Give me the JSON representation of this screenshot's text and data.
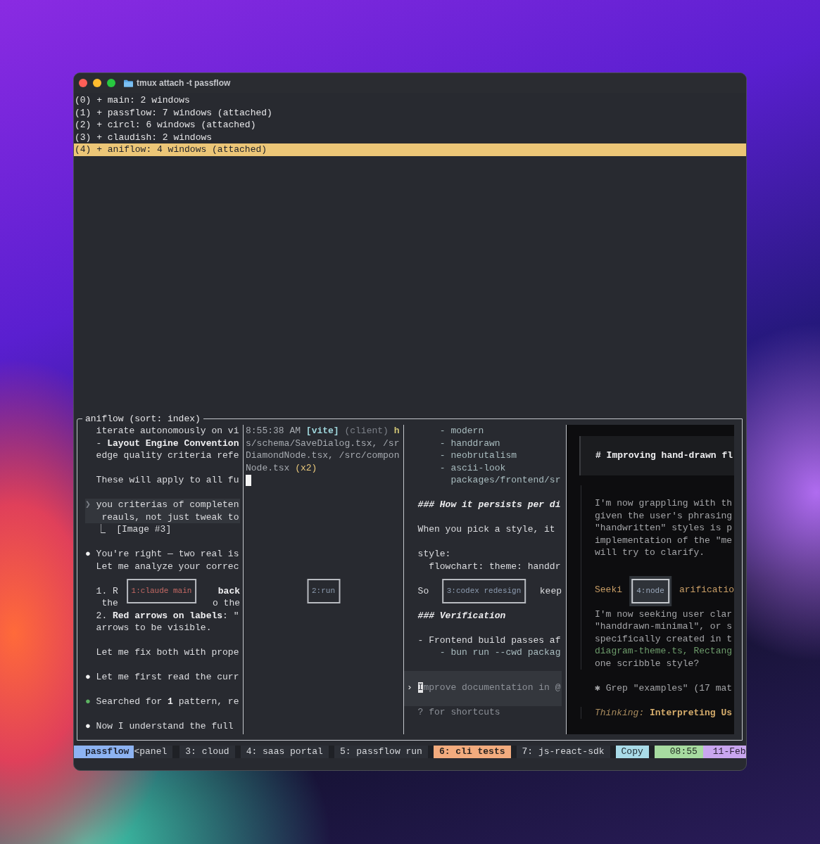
{
  "window": {
    "title": "tmux attach -t passflow"
  },
  "sessions": [
    {
      "label": "(0) + main: 2 windows",
      "selected": false
    },
    {
      "label": "(1) + passflow: 7 windows (attached)",
      "selected": false
    },
    {
      "label": "(2) + circl: 6 windows (attached)",
      "selected": false
    },
    {
      "label": "(3) + claudish: 2 windows",
      "selected": false
    },
    {
      "label": "(4) + aniflow: 4 windows (attached)",
      "selected": true
    }
  ],
  "preview": {
    "title": "aniflow (sort: index)",
    "panes": [
      {
        "kind": "terminal",
        "label": "1:claude main",
        "selected": true,
        "blocks": [
          {
            "kind": "plain",
            "lines": [
              {
                "kind": "text",
                "segments": [
                  {
                    "text": "  iterate autonomously on vi",
                    "kind": "plain"
                  }
                ]
              },
              {
                "kind": "text",
                "segments": [
                  {
                    "text": "  - ",
                    "kind": "plain"
                  },
                  {
                    "text": "Layout Engine Convention",
                    "kind": "bold"
                  }
                ]
              },
              {
                "kind": "text",
                "segments": [
                  {
                    "text": "  edge quality criteria refe",
                    "kind": "plain"
                  }
                ]
              },
              {
                "kind": "blank"
              },
              {
                "kind": "text",
                "segments": [
                  {
                    "text": "  These will apply to all fu",
                    "kind": "plain"
                  }
                ]
              },
              {
                "kind": "blank"
              }
            ]
          },
          {
            "kind": "quote",
            "lines": [
              {
                "kind": "text",
                "segments": [
                  {
                    "text": "❯",
                    "kind": "faint"
                  },
                  {
                    "text": " you criterias of completen",
                    "kind": "plain"
                  }
                ]
              },
              {
                "kind": "text",
                "segments": [
                  {
                    "text": "   reauls, not just tweak to",
                    "kind": "plain"
                  }
                ]
              }
            ]
          },
          {
            "kind": "plain",
            "lines": [
              {
                "kind": "text",
                "segments": [
                  {
                    "text": "  ⎿  [Image #3]",
                    "kind": "plain"
                  }
                ]
              },
              {
                "kind": "blank"
              },
              {
                "kind": "text",
                "segments": [
                  {
                    "text": "●",
                    "kind": "bullet"
                  },
                  {
                    "text": " You're right — two real is",
                    "kind": "plain"
                  }
                ]
              },
              {
                "kind": "text",
                "segments": [
                  {
                    "text": "  Let me analyze your correc",
                    "kind": "plain"
                  }
                ]
              },
              {
                "kind": "blank"
              },
              {
                "kind": "split",
                "segments": [
                  {
                    "text": "  1. R",
                    "kind": "plain"
                  }
                ],
                "right": [
                  {
                    "text": "back",
                    "kind": "bold"
                  }
                ]
              },
              {
                "kind": "split",
                "segments": [
                  {
                    "text": "   the",
                    "kind": "plain"
                  }
                ],
                "right": [
                  {
                    "text": "o the",
                    "kind": "plain"
                  }
                ]
              },
              {
                "kind": "text",
                "segments": [
                  {
                    "text": "  2. ",
                    "kind": "plain"
                  },
                  {
                    "text": "Red arrows on labels",
                    "kind": "bold"
                  },
                  {
                    "text": ": \"",
                    "kind": "plain"
                  }
                ]
              },
              {
                "kind": "text",
                "segments": [
                  {
                    "text": "  arrows to be visible.",
                    "kind": "plain"
                  }
                ]
              },
              {
                "kind": "blank"
              },
              {
                "kind": "text",
                "segments": [
                  {
                    "text": "  Let me fix both with prope",
                    "kind": "plain"
                  }
                ]
              },
              {
                "kind": "blank"
              },
              {
                "kind": "text",
                "segments": [
                  {
                    "text": "●",
                    "kind": "bullet"
                  },
                  {
                    "text": " Let me first read the curr",
                    "kind": "plain"
                  }
                ]
              },
              {
                "kind": "blank"
              },
              {
                "kind": "text",
                "segments": [
                  {
                    "text": "●",
                    "kind": "bullet-ok"
                  },
                  {
                    "text": " Searched for ",
                    "kind": "plain"
                  },
                  {
                    "text": "1",
                    "kind": "bold"
                  },
                  {
                    "text": " pattern, re",
                    "kind": "plain"
                  }
                ]
              },
              {
                "kind": "blank"
              },
              {
                "kind": "text",
                "segments": [
                  {
                    "text": "●",
                    "kind": "bullet"
                  },
                  {
                    "text": " Now I understand the full",
                    "kind": "plain"
                  }
                ]
              }
            ]
          }
        ]
      },
      {
        "kind": "terminal",
        "label": "2:run",
        "selected": false,
        "blocks": [
          {
            "kind": "plain",
            "lines": [
              {
                "kind": "text",
                "segments": [
                  {
                    "text": "8:55:38 AM ",
                    "kind": "dim"
                  },
                  {
                    "text": "[vite]",
                    "kind": "cyan"
                  },
                  {
                    "text": " (client) ",
                    "kind": "faint"
                  },
                  {
                    "text": "h",
                    "kind": "olive"
                  }
                ]
              },
              {
                "kind": "text",
                "segments": [
                  {
                    "text": "s/schema/SaveDialog.tsx, /sr",
                    "kind": "dim"
                  }
                ]
              },
              {
                "kind": "text",
                "segments": [
                  {
                    "text": "DiamondNode.tsx, /src/compon",
                    "kind": "dim"
                  }
                ]
              },
              {
                "kind": "text",
                "segments": [
                  {
                    "text": "Node.tsx ",
                    "kind": "dim"
                  },
                  {
                    "text": "(x2)",
                    "kind": "yellow"
                  }
                ]
              },
              {
                "kind": "cursor"
              }
            ]
          }
        ]
      },
      {
        "kind": "terminal",
        "label": "3:codex redesign",
        "selected": false,
        "blocks": [
          {
            "kind": "plain",
            "lines": [
              {
                "kind": "text",
                "segments": [
                  {
                    "text": "      - modern",
                    "kind": "code"
                  }
                ]
              },
              {
                "kind": "text",
                "segments": [
                  {
                    "text": "      - handdrawn",
                    "kind": "code"
                  }
                ]
              },
              {
                "kind": "text",
                "segments": [
                  {
                    "text": "      - neobrutalism",
                    "kind": "code"
                  }
                ]
              },
              {
                "kind": "text",
                "segments": [
                  {
                    "text": "      - ascii-look",
                    "kind": "code"
                  }
                ]
              },
              {
                "kind": "text",
                "segments": [
                  {
                    "text": "        packages/frontend/sr",
                    "kind": "code"
                  }
                ]
              },
              {
                "kind": "blank"
              },
              {
                "kind": "text",
                "segments": [
                  {
                    "text": "  ### How it persists per di",
                    "kind": "heading"
                  }
                ]
              },
              {
                "kind": "blank"
              },
              {
                "kind": "text",
                "segments": [
                  {
                    "text": "  When you pick a style, it",
                    "kind": "plain"
                  }
                ]
              },
              {
                "kind": "blank"
              },
              {
                "kind": "text",
                "segments": [
                  {
                    "text": "  style:",
                    "kind": "plain"
                  }
                ]
              },
              {
                "kind": "text",
                "segments": [
                  {
                    "text": "    flowchart: theme: handdr",
                    "kind": "plain"
                  }
                ]
              },
              {
                "kind": "blank"
              },
              {
                "kind": "split",
                "segments": [
                  {
                    "text": "  So",
                    "kind": "plain"
                  }
                ],
                "right": [
                  {
                    "text": "keep",
                    "kind": "plain"
                  }
                ]
              },
              {
                "kind": "blank"
              },
              {
                "kind": "text",
                "segments": [
                  {
                    "text": "  ### Verification",
                    "kind": "heading"
                  }
                ]
              },
              {
                "kind": "blank"
              },
              {
                "kind": "text",
                "segments": [
                  {
                    "text": "  - Frontend build passes af",
                    "kind": "plain"
                  }
                ]
              },
              {
                "kind": "text",
                "segments": [
                  {
                    "text": "      - bun run --cwd packag",
                    "kind": "code"
                  }
                ]
              },
              {
                "kind": "blank"
              }
            ]
          },
          {
            "kind": "input",
            "prompt": "›",
            "cursor_char": "I",
            "text": "mprove documentation in @"
          },
          {
            "kind": "plain",
            "lines": [
              {
                "kind": "text",
                "segments": [
                  {
                    "text": "  ? for shortcuts",
                    "kind": "prompt-dim"
                  }
                ]
              }
            ]
          }
        ]
      },
      {
        "kind": "dark",
        "label": "4:node",
        "selected": false,
        "blocks": [
          {
            "kind": "heading",
            "lines": [
              {
                "kind": "text",
                "segments": [
                  {
                    "text": "# Improving hand-drawn fl",
                    "kind": "bold"
                  }
                ]
              }
            ]
          },
          {
            "kind": "thought",
            "lines": [
              {
                "kind": "blank"
              },
              {
                "kind": "text",
                "segments": [
                  {
                    "text": "I'm now grappling with th",
                    "kind": "muted"
                  }
                ]
              },
              {
                "kind": "text",
                "segments": [
                  {
                    "text": "given the user's phrasing",
                    "kind": "muted"
                  }
                ]
              },
              {
                "kind": "text",
                "segments": [
                  {
                    "text": "\"handwritten\" styles is p",
                    "kind": "muted"
                  }
                ]
              },
              {
                "kind": "text",
                "segments": [
                  {
                    "text": "implementation of the \"me",
                    "kind": "muted"
                  }
                ]
              },
              {
                "kind": "text",
                "segments": [
                  {
                    "text": "will try to clarify.",
                    "kind": "muted"
                  }
                ]
              },
              {
                "kind": "blank"
              },
              {
                "kind": "blank"
              },
              {
                "kind": "split",
                "segments": [
                  {
                    "text": "Seeki",
                    "kind": "orange"
                  }
                ],
                "right": [
                  {
                    "text": "arificatio",
                    "kind": "orange"
                  }
                ]
              },
              {
                "kind": "blank"
              },
              {
                "kind": "text",
                "segments": [
                  {
                    "text": "I'm now seeking user clar",
                    "kind": "muted"
                  }
                ]
              },
              {
                "kind": "text",
                "segments": [
                  {
                    "text": "\"handdrawn-minimal\", or s",
                    "kind": "muted"
                  }
                ]
              },
              {
                "kind": "text",
                "segments": [
                  {
                    "text": "specifically created in t",
                    "kind": "muted"
                  }
                ]
              },
              {
                "kind": "text",
                "segments": [
                  {
                    "text": "diagram-theme.ts, Rectang",
                    "kind": "green"
                  }
                ]
              },
              {
                "kind": "text",
                "segments": [
                  {
                    "text": "one scribble style?",
                    "kind": "muted"
                  }
                ]
              }
            ]
          },
          {
            "kind": "plain",
            "lines": [
              {
                "kind": "blank"
              },
              {
                "kind": "text",
                "segments": [
                  {
                    "text": "✱ Grep \"examples\" (17 mat",
                    "kind": "muted"
                  }
                ]
              },
              {
                "kind": "blank"
              }
            ]
          },
          {
            "kind": "thinking",
            "lines": [
              {
                "kind": "text",
                "segments": [
                  {
                    "text": "Thinking:",
                    "kind": "orange-italic"
                  },
                  {
                    "text": " Interpreting Us",
                    "kind": "orange-bold"
                  }
                ]
              }
            ]
          }
        ]
      }
    ]
  },
  "status_bar": {
    "session": "passflow",
    "windows": [
      {
        "label": "<panel",
        "selected": false
      },
      {
        "label": "3: cloud",
        "selected": false
      },
      {
        "label": "4: saas portal",
        "selected": false
      },
      {
        "label": "5: passflow run",
        "selected": false
      },
      {
        "label": "6: cli tests",
        "selected": true
      },
      {
        "label": "7: js-react-sdk",
        "selected": false
      }
    ],
    "mode": "Copy",
    "time": "08:55",
    "date": "11-Feb"
  }
}
